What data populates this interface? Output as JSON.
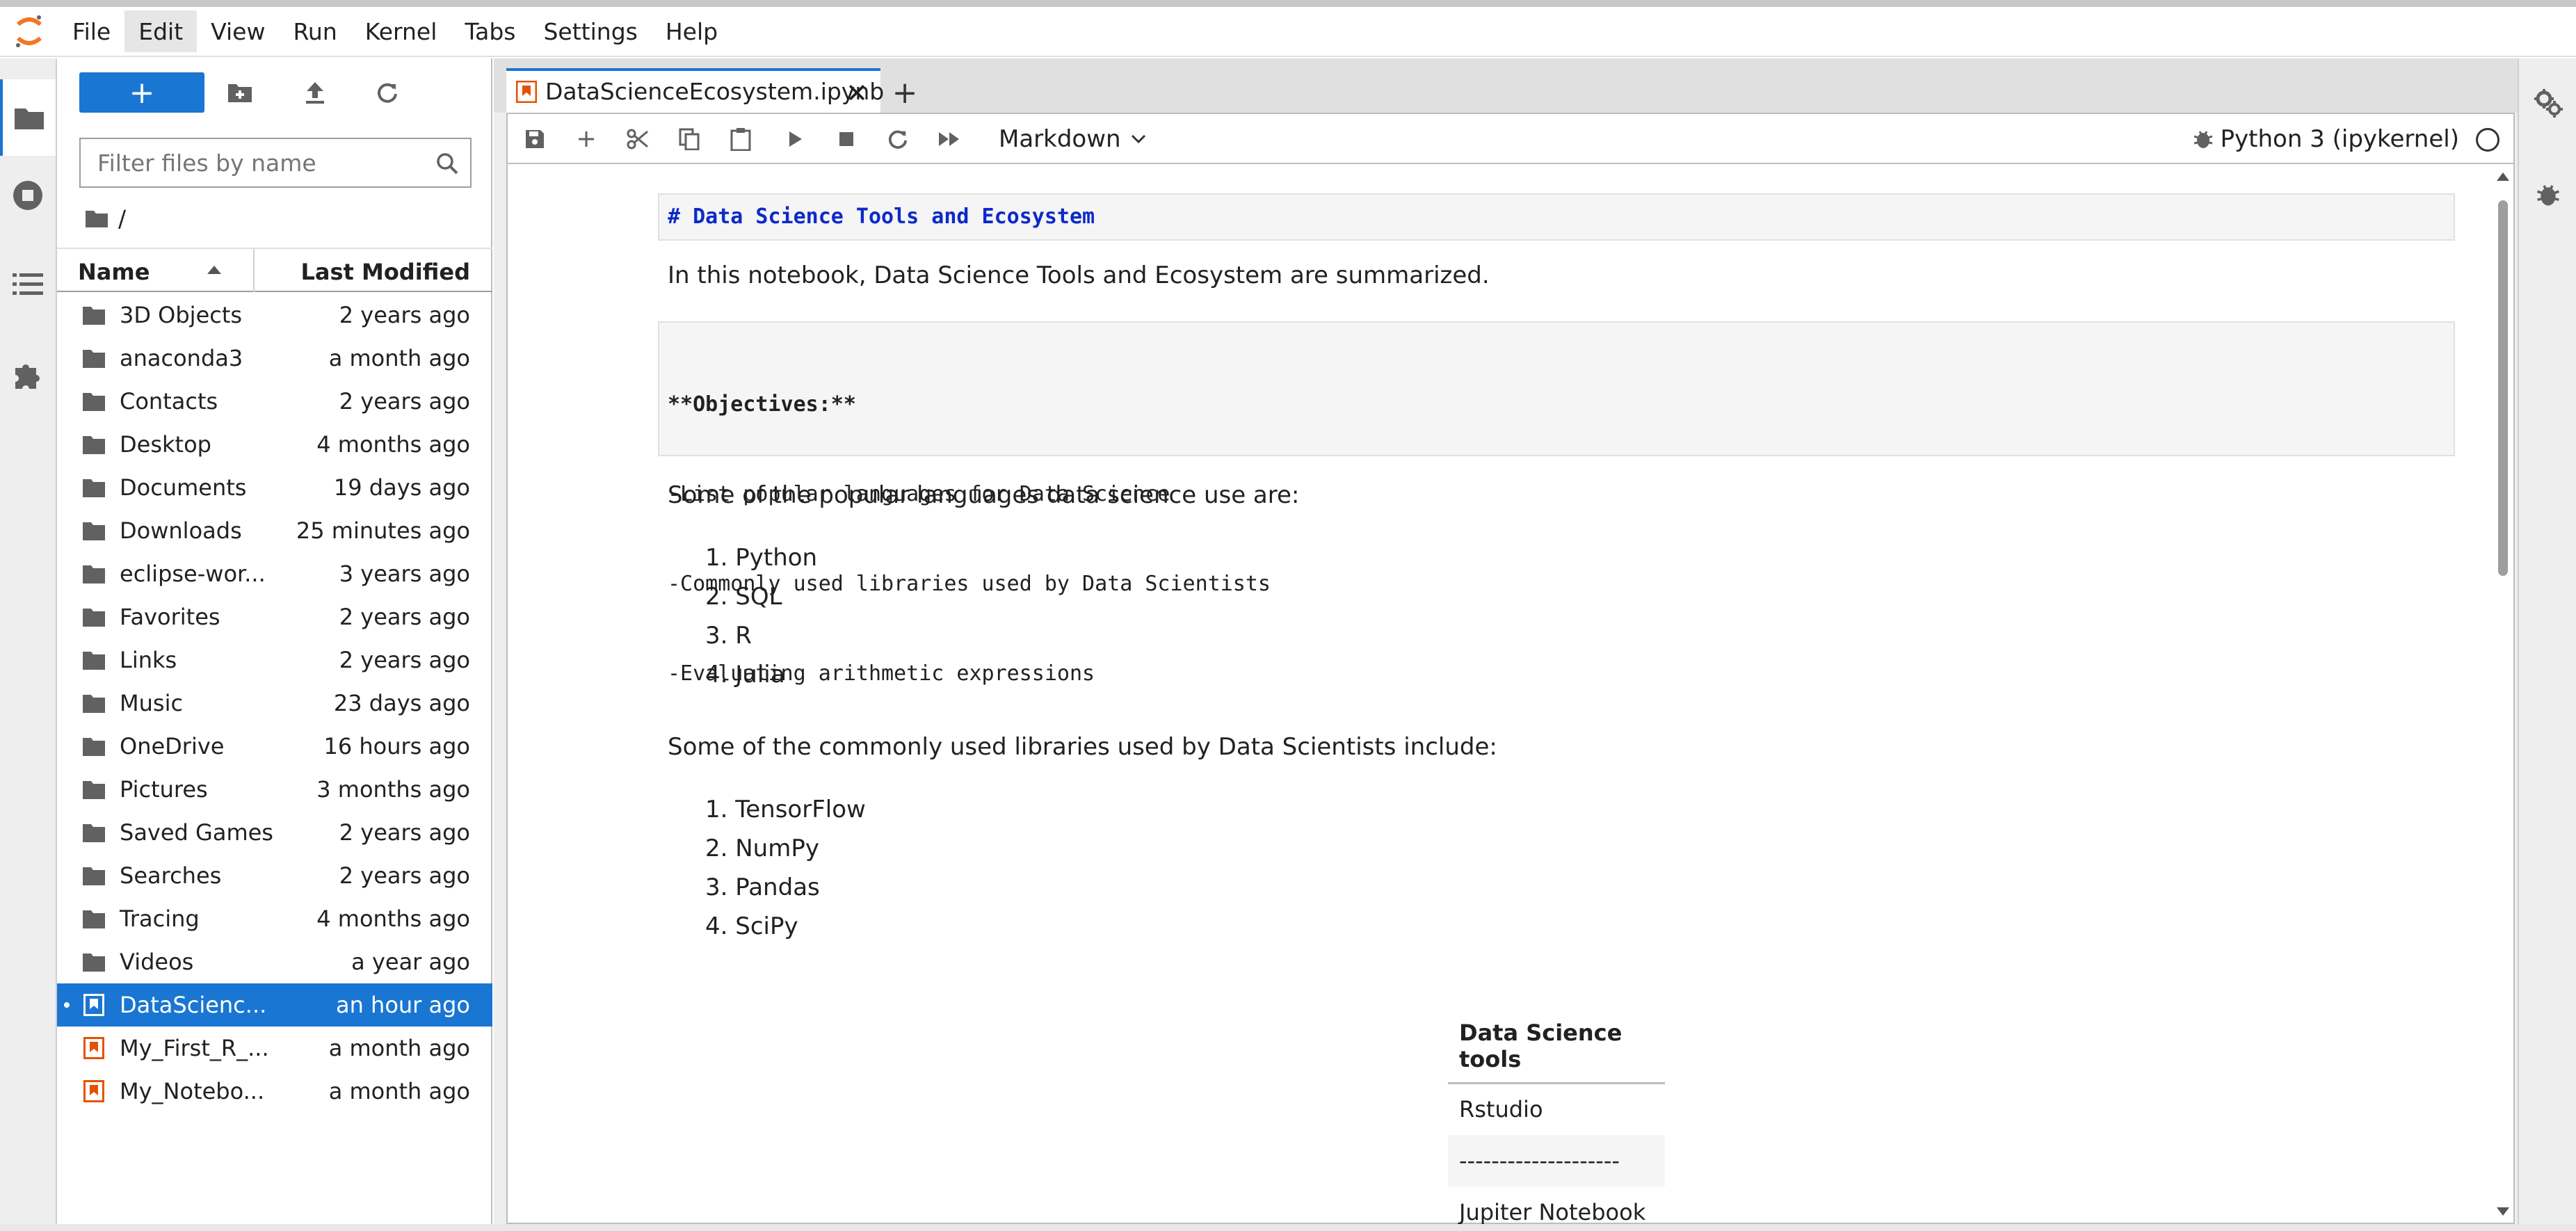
{
  "menubar": {
    "items": [
      "File",
      "Edit",
      "View",
      "Run",
      "Kernel",
      "Tabs",
      "Settings",
      "Help"
    ],
    "active": "Edit"
  },
  "filebrowser": {
    "new_label": "+",
    "filter_placeholder": "Filter files by name",
    "breadcrumb": "/",
    "columns": {
      "name": "Name",
      "modified": "Last Modified"
    },
    "files": [
      {
        "name": "3D Objects",
        "modified": "2 years ago",
        "type": "folder"
      },
      {
        "name": "anaconda3",
        "modified": "a month ago",
        "type": "folder"
      },
      {
        "name": "Contacts",
        "modified": "2 years ago",
        "type": "folder"
      },
      {
        "name": "Desktop",
        "modified": "4 months ago",
        "type": "folder"
      },
      {
        "name": "Documents",
        "modified": "19 days ago",
        "type": "folder"
      },
      {
        "name": "Downloads",
        "modified": "25 minutes ago",
        "type": "folder"
      },
      {
        "name": "eclipse-wor...",
        "modified": "3 years ago",
        "type": "folder"
      },
      {
        "name": "Favorites",
        "modified": "2 years ago",
        "type": "folder"
      },
      {
        "name": "Links",
        "modified": "2 years ago",
        "type": "folder"
      },
      {
        "name": "Music",
        "modified": "23 days ago",
        "type": "folder"
      },
      {
        "name": "OneDrive",
        "modified": "16 hours ago",
        "type": "folder"
      },
      {
        "name": "Pictures",
        "modified": "3 months ago",
        "type": "folder"
      },
      {
        "name": "Saved Games",
        "modified": "2 years ago",
        "type": "folder"
      },
      {
        "name": "Searches",
        "modified": "2 years ago",
        "type": "folder"
      },
      {
        "name": "Tracing",
        "modified": "4 months ago",
        "type": "folder"
      },
      {
        "name": "Videos",
        "modified": "a year ago",
        "type": "folder"
      },
      {
        "name": "DataScienc...",
        "modified": "an hour ago",
        "type": "notebook",
        "selected": true
      },
      {
        "name": "My_First_R_...",
        "modified": "a month ago",
        "type": "notebook"
      },
      {
        "name": "My_Notebo...",
        "modified": "a month ago",
        "type": "notebook"
      }
    ]
  },
  "tabs": {
    "active_title": "DataScienceEcosystem.ipynb",
    "close_glyph": "✕",
    "add_glyph": "+"
  },
  "toolbar": {
    "cell_type": "Markdown",
    "kernel_name": "Python 3 (ipykernel)"
  },
  "notebook": {
    "heading_source": "# Data Science Tools and Ecosystem",
    "intro": "In this notebook, Data Science Tools and Ecosystem are summarized.",
    "objectives_title": "**Objectives:**",
    "objectives": [
      "-List popular languages for Data Science",
      "-Commonly used libraries used by Data Scientists",
      "-Evaluating arithmetic expressions"
    ],
    "languages_intro": "Some of the popular languages data science use are:",
    "languages": [
      "1. Python",
      "2. SQL",
      "3. R",
      "4. Julia"
    ],
    "libraries_intro": "Some of the commonly used libraries used by Data Scientists include:",
    "libraries": [
      "1. TensorFlow",
      "2. NumPy",
      "3. Pandas",
      "4. SciPy"
    ],
    "table": {
      "header": "Data Science tools",
      "rows": [
        "Rstudio",
        "--------------------",
        "Jupiter Notebook"
      ]
    }
  },
  "colors": {
    "accent": "#1976d2",
    "notebook_icon": "#e65100",
    "heading_code": "#0d2ac9"
  }
}
